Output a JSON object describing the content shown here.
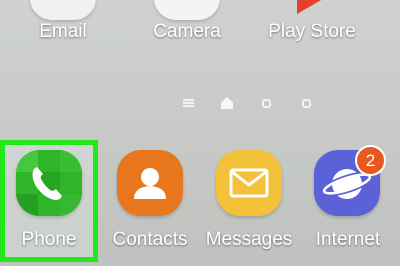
{
  "top_row": {
    "apps": [
      {
        "label": "Email",
        "icon": "email-icon"
      },
      {
        "label": "Camera",
        "icon": "camera-icon"
      },
      {
        "label": "Play Store",
        "icon": "play-store-icon"
      }
    ]
  },
  "page_indicator": {
    "current": "home"
  },
  "dock": {
    "apps": [
      {
        "label": "Phone",
        "icon": "phone-icon",
        "highlighted": true
      },
      {
        "label": "Contacts",
        "icon": "contacts-icon"
      },
      {
        "label": "Messages",
        "icon": "messages-icon"
      },
      {
        "label": "Internet",
        "icon": "internet-icon",
        "badge": "2"
      }
    ]
  },
  "colors": {
    "highlight": "#22e81b",
    "phone": "#2fb52a",
    "contacts": "#e8761d",
    "messages": "#f3c23a",
    "internet": "#5b61d6",
    "badge": "#e8591f"
  }
}
